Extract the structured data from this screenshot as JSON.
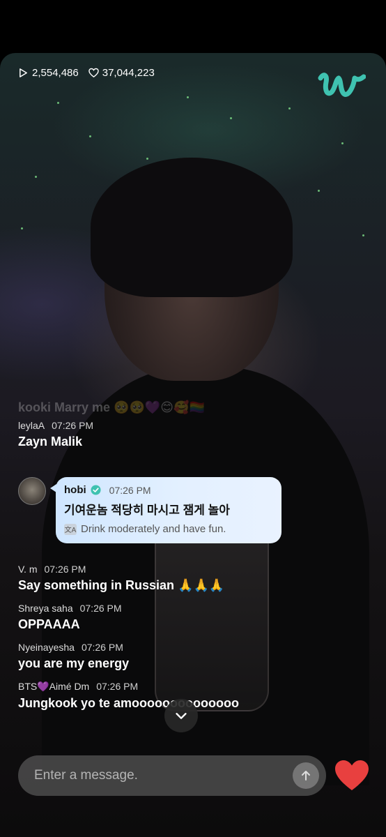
{
  "stats": {
    "plays": "2,554,486",
    "likes": "37,044,223"
  },
  "faded_message": "kooki Marry me 🥺🥺💜😊🥰🏳️‍🌈",
  "messages_top": [
    {
      "user": "leylaA",
      "time": "07:26 PM",
      "text": "Zayn Malik"
    }
  ],
  "artist_message": {
    "user": "hobi",
    "time": "07:26 PM",
    "text": "기여운놈 적당히 마시고 잼게 놀아",
    "translation_icon": "文A",
    "translation": "Drink moderately and have fun."
  },
  "messages_bottom": [
    {
      "user": "V. m",
      "time": "07:26 PM",
      "text": "Say something in Russian 🙏🙏🙏"
    },
    {
      "user": "Shreya saha",
      "time": "07:26 PM",
      "text": "OPPAAAA"
    },
    {
      "user": "Nyeinayesha",
      "time": "07:26 PM",
      "text": "you are my energy"
    },
    {
      "user": "BTS💜Aimé Dm",
      "time": "07:26 PM",
      "text": "Jungkook yo te amoooooooooooooo"
    }
  ],
  "input": {
    "placeholder": "Enter a message."
  },
  "colors": {
    "brand": "#3fc2b0",
    "heart": "#e8403f",
    "bubble": "#dbeaff"
  }
}
